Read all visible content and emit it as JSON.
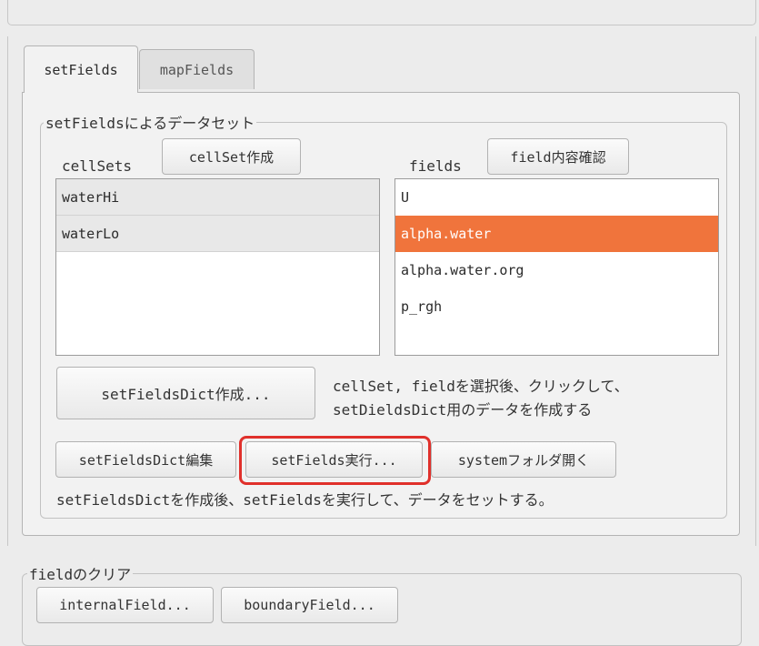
{
  "tabs": [
    {
      "label": "setFields",
      "active": true
    },
    {
      "label": "mapFields",
      "active": false
    }
  ],
  "setfields_group": {
    "title": "setFieldsによるデータセット",
    "cellsets": {
      "label": "cellSets",
      "create_button": "cellSet作成",
      "items": [
        "waterHi",
        "waterLo"
      ]
    },
    "fields": {
      "label": "fields",
      "check_button": "field内容確認",
      "items": [
        "U",
        "alpha.water",
        "alpha.water.org",
        "p_rgh"
      ],
      "selected": "alpha.water"
    },
    "create_dict_button": "setFieldsDict作成...",
    "create_dict_desc": [
      "cellSet, fieldを選択後、クリックして、",
      "setDieldsDict用のデータを作成する"
    ],
    "edit_dict_button": "setFieldsDict編集",
    "run_button": "setFields実行...",
    "open_system_button": "systemフォルダ開く",
    "run_desc": "setFieldsDictを作成後、setFieldsを実行して、データをセットする。"
  },
  "clear_group": {
    "title": "fieldのクリア",
    "internal_button": "internalField...",
    "boundary_button": "boundaryField..."
  },
  "colors": {
    "selection": "#f0743c",
    "highlight": "#e0302b",
    "panel_bg": "#f2f2f2",
    "window_bg": "#ececec"
  }
}
